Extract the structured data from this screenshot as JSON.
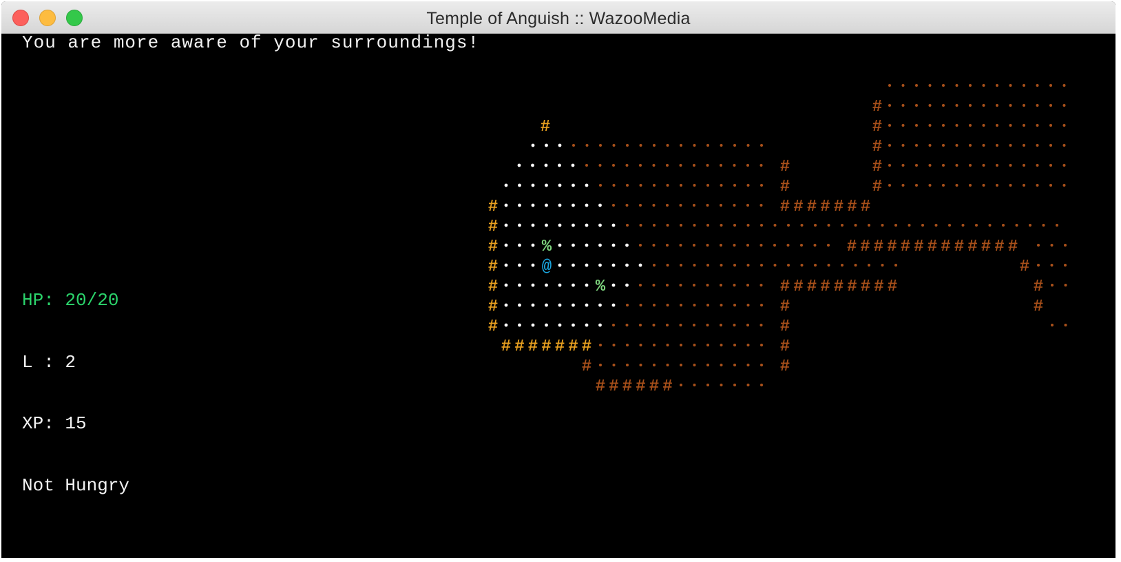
{
  "window": {
    "title": "Temple of Anguish :: WazooMedia",
    "controls": [
      "close",
      "minimize",
      "zoom"
    ]
  },
  "game": {
    "message": "You are more aware of your surroundings!",
    "stats": {
      "hp": "HP: 20/20",
      "level": "L : 2",
      "xp": "XP: 15",
      "hunger": "Not Hungry"
    },
    "player_glyph": "@",
    "item_glyph": "%",
    "wall_glyph": "#",
    "floor_glyph": ".",
    "colors": {
      "background": "#000000",
      "hp": "#2bd36b",
      "text": "#f2f2f2",
      "wall_visible": "#e8a020",
      "wall_remembered": "#a8501a",
      "floor_visible": "#ffffff",
      "floor_remembered": "#a8501a",
      "player": "#1aa7e0",
      "item": "#7fd67f"
    }
  }
}
